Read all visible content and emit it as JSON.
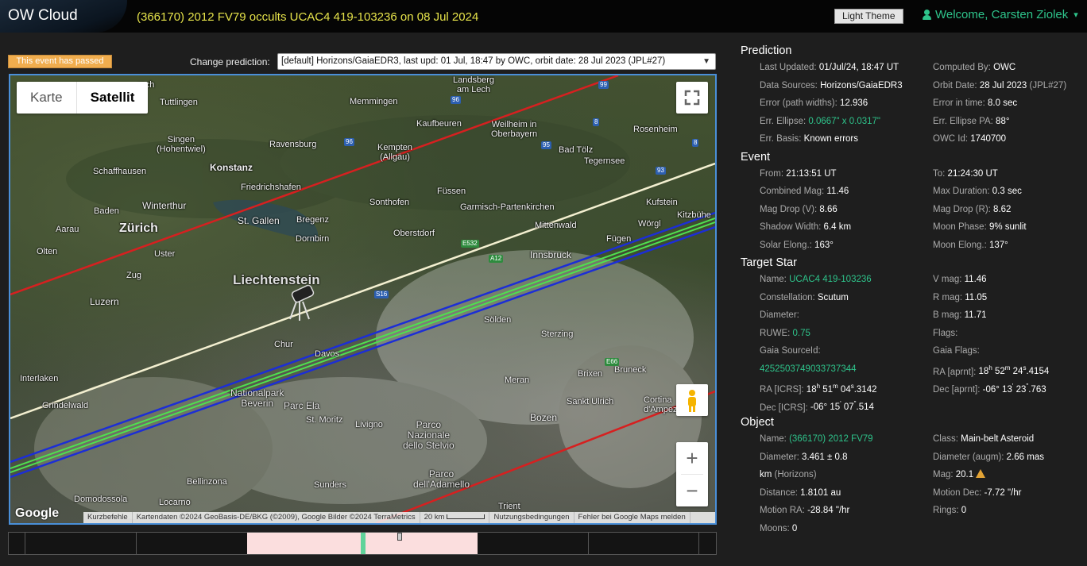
{
  "header": {
    "brand": "OW Cloud",
    "event_title": "(366170) 2012 FV79 occults UCAC4 419-103236 on 08 Jul 2024",
    "theme_button": "Light Theme",
    "welcome": "Welcome, Carsten Ziolek"
  },
  "controls": {
    "passed_badge": "This event has passed",
    "change_label": "Change prediction:",
    "selected_prediction": "[default] Horizons/GaiaEDR3, last upd: 01 Jul, 18:47 by OWC, orbit date: 28 Jul 2023 (JPL#27)"
  },
  "map": {
    "map_types": [
      "Karte",
      "Satellit"
    ],
    "active_type": "Satellit",
    "labels": {
      "tuttlingen": "Tuttlingen",
      "memmingen": "Memmingen",
      "landsberg": "Landsberg\nam Lech",
      "kaufbeuren": "Kaufbeuren",
      "weilheim": "Weilheim in\nOberbayern",
      "singen": "Singen\n(Hohentwiel)",
      "ravensburg": "Ravensburg",
      "kempten": "Kempten\n(Allgäu)",
      "badtolz": "Bad Tölz",
      "tegernsee": "Tegernsee",
      "rosenheim": "Rosenheim",
      "schaffhausen": "Schaffhausen",
      "konstanz": "Konstanz",
      "friedrichshafen": "Friedrichshafen",
      "winterthur": "Winterthur",
      "sonthofen": "Sonthofen",
      "fussen": "Füssen",
      "garmisch": "Garmisch-Partenkirchen",
      "kufstein": "Kufstein",
      "baden": "Baden",
      "zurich": "Zürich",
      "stgallen": "St. Gallen",
      "bregenz": "Bregenz",
      "dornbirn": "Dornbirn",
      "oberstdorf": "Oberstdorf",
      "mittenwald": "Mittenwald",
      "worgl": "Wörgl",
      "aarau": "Aarau",
      "olten": "Olten",
      "uster": "Uster",
      "fugen": "Fügen",
      "kitzbuhel": "Kitzbühe",
      "innsbruck": "Innsbruck",
      "zug": "Zug",
      "liechtenstein": "Liechtenstein",
      "luzern": "Luzern",
      "solden": "Sölden",
      "chur": "Chur",
      "davos": "Davos",
      "sterzing": "Sterzing",
      "interlaken": "Interlaken",
      "brixen": "Brixen",
      "bruneck": "Bruneck",
      "meran": "Meran",
      "grindelwald": "Grindelwald",
      "nationalpark": "Nationalpark\nBeverin",
      "parcela": "Parc Ela",
      "sanktulrich": "Sankt Ulrich",
      "cortina": "Cortina\nd'Ampezzo",
      "stmoritz": "St. Moritz",
      "livigno": "Livigno",
      "parcostelvio": "Parco\nNazionale\ndello Stelvio",
      "bozen": "Bozen",
      "bellinzona": "Bellinzona",
      "sunders": "Sunders",
      "parcoadamello": "Parco\ndell'Adamello",
      "domodossola": "Domodossola",
      "locarno": "Locarno",
      "trient": "Trient",
      "rach": "rach"
    },
    "roads": {
      "r99": "99",
      "r96a": "96",
      "r96b": "96",
      "r8a": "8",
      "r8b": "8",
      "r95": "95",
      "r93": "93",
      "e532": "E532",
      "a12": "A12",
      "s16": "S16",
      "e66": "E66"
    },
    "google": "Google",
    "attribution": [
      "Kurzbefehle",
      "Kartendaten ©2024 GeoBasis-DE/BKG (©2009), Google Bilder ©2024 TerraMetrics",
      "20 km",
      "Nutzungsbedingungen",
      "Fehler bei Google Maps melden"
    ],
    "zoom_in": "+",
    "zoom_out": "−"
  },
  "prediction": {
    "title": "Prediction",
    "last_updated_label": "Last Updated: ",
    "last_updated": "01/Jul/24, 18:47 UT",
    "computed_by_label": "Computed By: ",
    "computed_by": "OWC",
    "data_sources_label": "Data Sources: ",
    "data_sources": "Horizons/GaiaEDR3",
    "orbit_date_label": "Orbit Date: ",
    "orbit_date": "28 Jul 2023 ",
    "orbit_ref": "(JPL#27)",
    "error_label": "Error (path widths): ",
    "error": "12.936",
    "error_time_label": "Error in time: ",
    "error_time": "8.0 sec",
    "err_ellipse_label": "Err. Ellipse: ",
    "err_ellipse": "0.0667\" x 0.0317\"",
    "err_ellipse_pa_label": "Err. Ellipse PA: ",
    "err_ellipse_pa": "88°",
    "err_basis_label": "Err. Basis: ",
    "err_basis": "Known errors",
    "owc_id_label": "OWC Id: ",
    "owc_id": "1740700"
  },
  "event": {
    "title": "Event",
    "from_label": "From: ",
    "from": "21:13:51 UT",
    "to_label": "To: ",
    "to": "21:24:30 UT",
    "combined_mag_label": "Combined Mag: ",
    "combined_mag": "11.46",
    "max_duration_label": "Max Duration: ",
    "max_duration": "0.3 sec",
    "mag_drop_v_label": "Mag Drop (V): ",
    "mag_drop_v": "8.66",
    "mag_drop_r_label": "Mag Drop (R): ",
    "mag_drop_r": "8.62",
    "shadow_width_label": "Shadow Width: ",
    "shadow_width": "6.4 km",
    "moon_phase_label": "Moon Phase: ",
    "moon_phase": "9% sunlit",
    "solar_elong_label": "Solar Elong.: ",
    "solar_elong": "163°",
    "moon_elong_label": "Moon Elong.: ",
    "moon_elong": "137°"
  },
  "target_star": {
    "title": "Target Star",
    "name_label": "Name: ",
    "name": "UCAC4 419-103236",
    "v_mag_label": "V mag: ",
    "v_mag": "11.46",
    "constellation_label": "Constellation: ",
    "constellation": "Scutum",
    "r_mag_label": "R mag: ",
    "r_mag": "11.05",
    "diameter_label": "Diameter:",
    "b_mag_label": "B mag: ",
    "b_mag": "11.71",
    "ruwe_label": "RUWE: ",
    "ruwe": "0.75",
    "flags_label": "Flags:",
    "gaia_sourceid_label": "Gaia SourceId:",
    "gaia_flags_label": "Gaia Flags:",
    "gaia_sourceid": "4252503749033737344",
    "ra_aprnt_label": "RA [aprnt]: ",
    "ra_aprnt": {
      "h": "18",
      "m": "52",
      "s": "24",
      "frac": ".4154"
    },
    "ra_icrs_label": "RA [ICRS]: ",
    "ra_icrs": {
      "h": "18",
      "m": "51",
      "s": "04",
      "frac": ".3142"
    },
    "dec_aprnt_label": "Dec [aprnt]: ",
    "dec_aprnt": {
      "d": "-06° 13",
      "m": "23",
      "frac": ".763"
    },
    "dec_icrs_label": "Dec [ICRS]: ",
    "dec_icrs": {
      "d": "-06° 15",
      "m": "07",
      "frac": ".514"
    }
  },
  "object": {
    "title": "Object",
    "name_label": "Name: ",
    "name": "(366170) 2012 FV79",
    "class_label": "Class: ",
    "class": "Main-belt Asteroid",
    "diameter_label": "Diameter: ",
    "diameter": "3.461 ± 0.8",
    "diameter_augm_label": "Diameter (augm): ",
    "diameter_augm": "2.66 mas",
    "diameter_unit": "km ",
    "diameter_source": "(Horizons)",
    "mag_label": "Mag: ",
    "mag": "20.1",
    "distance_label": "Distance: ",
    "distance": "1.8101 au",
    "motion_dec_label": "Motion Dec: ",
    "motion_dec": "-7.72 \"/hr",
    "motion_ra_label": "Motion RA: ",
    "motion_ra": "-28.84 \"/hr",
    "rings_label": "Rings: ",
    "rings": "0",
    "moons_label": "Moons: ",
    "moons": "0"
  },
  "colors": {
    "accent_green": "#2ec48b",
    "title_yellow": "#e6e34a",
    "path_red": "#d62020",
    "path_blue": "#1c2ed6",
    "path_green": "#4fe04f",
    "path_white": "#f3efd0"
  },
  "icons": [
    "user-icon",
    "caret-down-icon",
    "fullscreen-icon",
    "pegman-icon",
    "telescope-icon",
    "warning-icon"
  ]
}
